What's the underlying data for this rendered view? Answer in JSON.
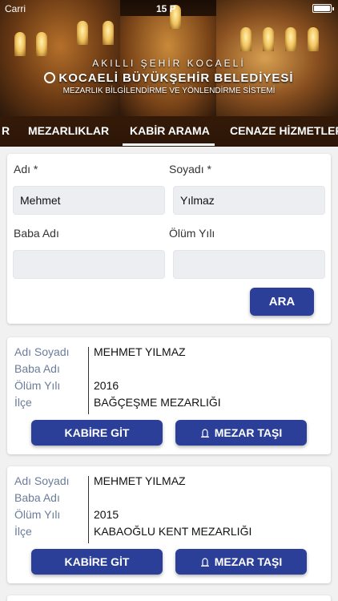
{
  "status_bar": {
    "carrier": "Carri",
    "time": "15 P"
  },
  "header": {
    "small_title": "AKILLI ŞEHİR KOCAELİ",
    "main_title": "KOCAELİ BÜYÜKŞEHİR BELEDİYESİ",
    "subtitle": "MEZARLIK BİLGİLENDİRME VE YÖNLENDİRME SİSTEMİ"
  },
  "tabs": [
    {
      "label": "R"
    },
    {
      "label": "MEZARLIKLAR"
    },
    {
      "label": "KABİR ARAMA",
      "active": true
    },
    {
      "label": "CENAZE HİZMETLER"
    }
  ],
  "search": {
    "first_name_label": "Adı *",
    "last_name_label": "Soyadı *",
    "first_name_value": "Mehmet",
    "last_name_value": "Yılmaz",
    "father_label": "Baba Adı",
    "death_year_label": "Ölüm Yılı",
    "father_value": "",
    "death_year_value": "",
    "search_button": "ARA"
  },
  "results_labels": {
    "name": "Adı Soyadı",
    "father": "Baba Adı",
    "death_year": "Ölüm Yılı",
    "district": "İlçe",
    "go_button": "KABİRE GİT",
    "stone_button": "MEZAR TAŞI"
  },
  "results": [
    {
      "name": "MEHMET YILMAZ",
      "father": "",
      "death_year": "2016",
      "district": "BAĞÇEŞME MEZARLIĞI"
    },
    {
      "name": "MEHMET YILMAZ",
      "father": "",
      "death_year": "2015",
      "district": "KABAOĞLU KENT MEZARLIĞI"
    }
  ],
  "colors": {
    "accent": "#2b3f99",
    "label": "#6a7c9a"
  },
  "icons": {
    "stone": "tombstone-icon",
    "logo": "municipality-logo-icon",
    "battery": "battery-icon"
  }
}
